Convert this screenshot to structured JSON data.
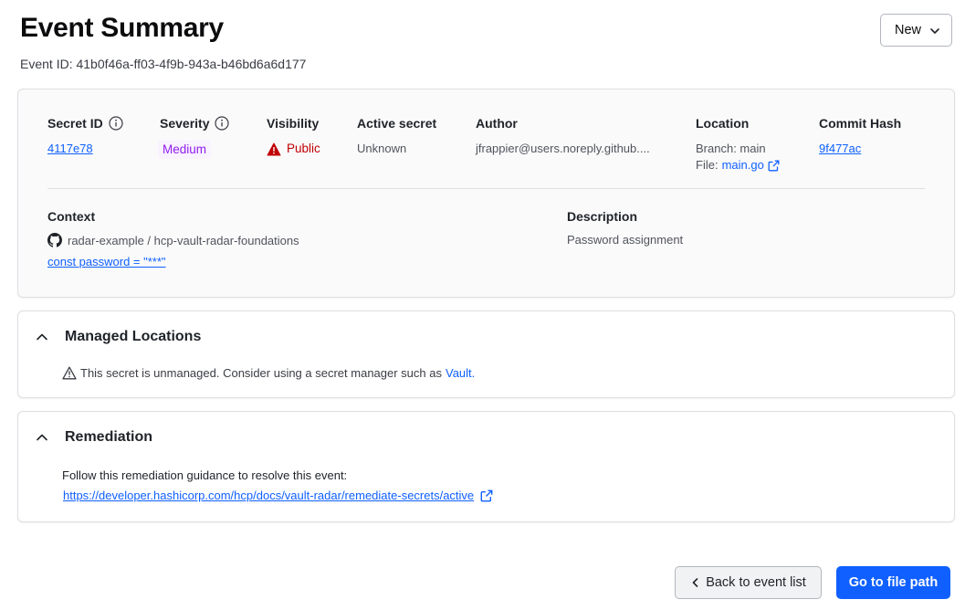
{
  "header": {
    "title": "Event Summary",
    "event_id": "Event ID: 41b0f46a-ff03-4f9b-943a-b46bd6a6d177",
    "status_value": "New"
  },
  "details": {
    "secret_id": {
      "label": "Secret ID",
      "value": "4117e78"
    },
    "severity": {
      "label": "Severity",
      "value": "Medium"
    },
    "visibility": {
      "label": "Visibility",
      "value": "Public"
    },
    "active_secret": {
      "label": "Active secret",
      "value": "Unknown"
    },
    "author": {
      "label": "Author",
      "value": "jfrappier@users.noreply.github...."
    },
    "location": {
      "label": "Location",
      "branch": "Branch: main",
      "file_prefix": "File:",
      "file": "main.go"
    },
    "commit_hash": {
      "label": "Commit Hash",
      "value": "9f477ac"
    },
    "context": {
      "label": "Context",
      "repo": "radar-example / hcp-vault-radar-foundations",
      "code": "const password = \"***\""
    },
    "description": {
      "label": "Description",
      "value": "Password assignment"
    }
  },
  "managed_locations": {
    "title": "Managed Locations",
    "message": "This secret is unmanaged. Consider using a secret manager such as",
    "link": "Vault."
  },
  "remediation": {
    "title": "Remediation",
    "message": "Follow this remediation guidance to resolve this event:",
    "link": "https://developer.hashicorp.com/hcp/docs/vault-radar/remediate-secrets/active"
  },
  "footer": {
    "back_label": "Back to event list",
    "goto_label": "Go to file path"
  },
  "colors": {
    "primary": "#1060ff",
    "severity_medium": "#911ced",
    "public_red": "#c00005"
  }
}
